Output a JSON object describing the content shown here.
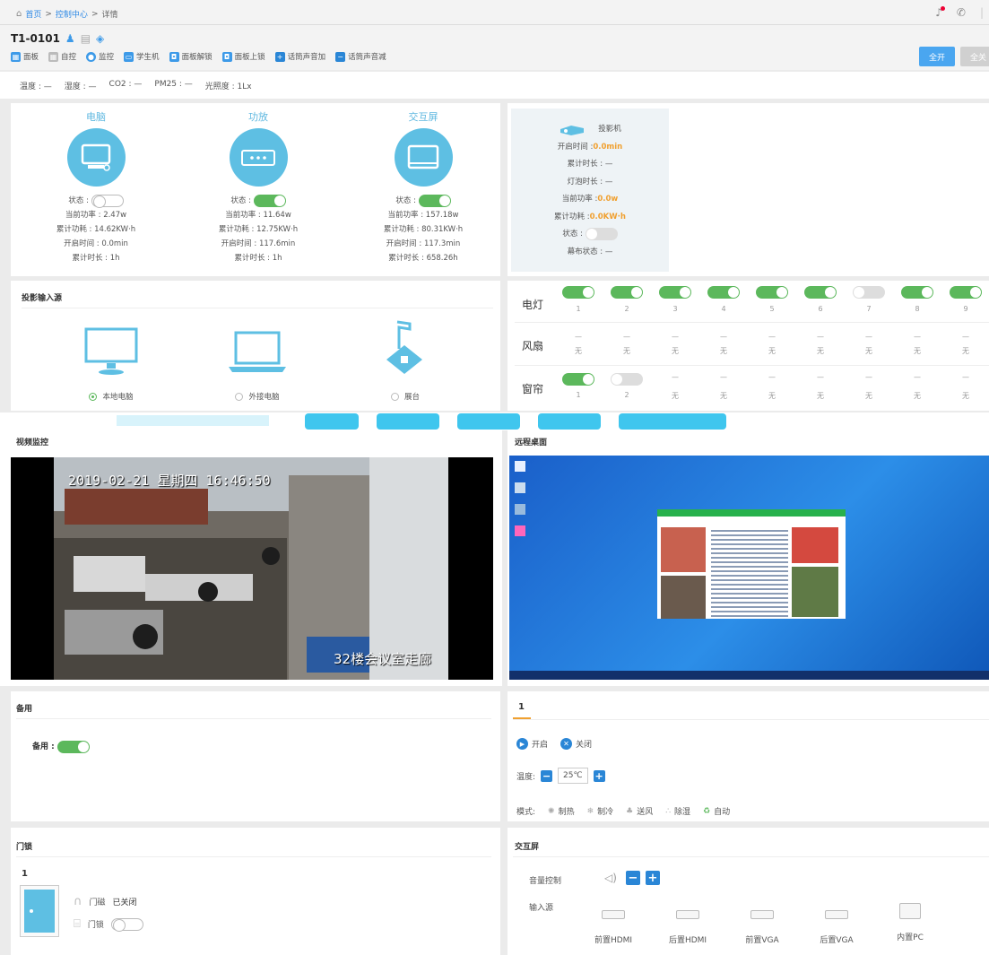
{
  "breadcrumb": {
    "home": "首页",
    "sep1": ">",
    "center": "控制中心",
    "sep2": ">",
    "current": "详情"
  },
  "room": {
    "title": "T1-0101"
  },
  "toolbar": [
    {
      "label": "面板",
      "icon": "panel-icon",
      "color": "#3d9ae8"
    },
    {
      "label": "自控",
      "icon": "auto-control-icon",
      "color": "#bbbbbb"
    },
    {
      "label": "监控",
      "icon": "camera-icon",
      "color": "#3d9ae8"
    },
    {
      "label": "学生机",
      "icon": "monitor-icon",
      "color": "#3d9ae8"
    },
    {
      "label": "面板解锁",
      "icon": "unlock-icon",
      "color": "#3d9ae8"
    },
    {
      "label": "面板上锁",
      "icon": "lock-icon",
      "color": "#3d9ae8"
    },
    {
      "label": "话筒声音加",
      "icon": "plus-square-icon",
      "color": "#2a86d6"
    },
    {
      "label": "话筒声音减",
      "icon": "minus-square-icon",
      "color": "#2a86d6"
    }
  ],
  "header_buttons": {
    "all_on": "全开",
    "all_off": "全关"
  },
  "sensors": [
    "温度 : —",
    "湿度 : —",
    "CO2 : —",
    "PM25 : —",
    "光照度 : 1Lx"
  ],
  "devices": [
    {
      "name": "电脑",
      "status_label": "状态 :",
      "status_on": false,
      "power": "当前功率 : 2.47w",
      "energy": "累计功耗 : 14.62KW·h",
      "open_time": "开启时间 : 0.0min",
      "total_time": "累计时长 : 1h"
    },
    {
      "name": "功放",
      "status_label": "状态 :",
      "status_on": true,
      "power": "当前功率 : 11.64w",
      "energy": "累计功耗 : 12.75KW·h",
      "open_time": "开启时间 : 117.6min",
      "total_time": "累计时长 : 1h"
    },
    {
      "name": "交互屏",
      "status_label": "状态 :",
      "status_on": true,
      "power": "当前功率 : 157.18w",
      "energy": "累计功耗 : 80.31KW·h",
      "open_time": "开启时间 : 117.3min",
      "total_time": "累计时长 : 658.26h"
    }
  ],
  "projector": {
    "name": "投影机",
    "open_time_label": "开启时间 :",
    "open_time_value": "0.0min",
    "total_time": "累计时长 : —",
    "lamp_time": "灯泡时长 : —",
    "power_label": "当前功率 :",
    "power_value": "0.0w",
    "energy_label": "累计功耗 :",
    "energy_value": "0.0KW·h",
    "status_label": "状态 :",
    "screen_status": "幕布状态 : —"
  },
  "projection_source": {
    "title": "投影输入源",
    "items": [
      {
        "label": "本地电脑",
        "selected": true
      },
      {
        "label": "外接电脑",
        "selected": false
      },
      {
        "label": "展台",
        "selected": false
      }
    ]
  },
  "lights": {
    "label": "电灯",
    "items": [
      {
        "n": "1",
        "on": true
      },
      {
        "n": "2",
        "on": true
      },
      {
        "n": "3",
        "on": true
      },
      {
        "n": "4",
        "on": true
      },
      {
        "n": "5",
        "on": true
      },
      {
        "n": "6",
        "on": true
      },
      {
        "n": "7",
        "on": false
      },
      {
        "n": "8",
        "on": true
      },
      {
        "n": "9",
        "on": true
      }
    ]
  },
  "fans": {
    "label": "风扇",
    "dash": "—",
    "items": [
      "无",
      "无",
      "无",
      "无",
      "无",
      "无",
      "无",
      "无",
      "无"
    ]
  },
  "curtains": {
    "label": "窗帘",
    "dash": "—",
    "items": [
      {
        "n": "1",
        "toggle": true,
        "on": true
      },
      {
        "n": "2",
        "toggle": true,
        "on": false
      },
      {
        "n": "无"
      },
      {
        "n": "无"
      },
      {
        "n": "无"
      },
      {
        "n": "无"
      },
      {
        "n": "无"
      },
      {
        "n": "无"
      },
      {
        "n": "无"
      }
    ]
  },
  "video": {
    "title": "视频监控",
    "timestamp": "2019-02-21 星期四 16:46:50",
    "caption": "32楼会议室走廊"
  },
  "remote": {
    "title": "远程桌面"
  },
  "backup": {
    "title": "备用",
    "toggle_label": "备用 :",
    "on": true
  },
  "ac": {
    "tab": "1",
    "on_label": "开启",
    "off_label": "关闭",
    "temp_label": "温度:",
    "temp_value": "25℃",
    "mode_label": "模式:",
    "modes": [
      {
        "label": "制热",
        "icon": "sun-icon"
      },
      {
        "label": "制冷",
        "icon": "snowflake-icon"
      },
      {
        "label": "送风",
        "icon": "fan-icon"
      },
      {
        "label": "除湿",
        "icon": "drops-icon"
      },
      {
        "label": "自动",
        "icon": "recycle-icon",
        "color": "#5cb85c"
      }
    ]
  },
  "door": {
    "title": "门锁",
    "index": "1",
    "sensor_label": "门磁",
    "sensor_value": "已关闭",
    "lock_label": "门锁"
  },
  "interactive": {
    "title": "交互屏",
    "volume_label": "音量控制",
    "input_label": "输入源",
    "ports": [
      "前置HDMI",
      "后置HDMI",
      "前置VGA",
      "后置VGA",
      "内置PC"
    ]
  }
}
